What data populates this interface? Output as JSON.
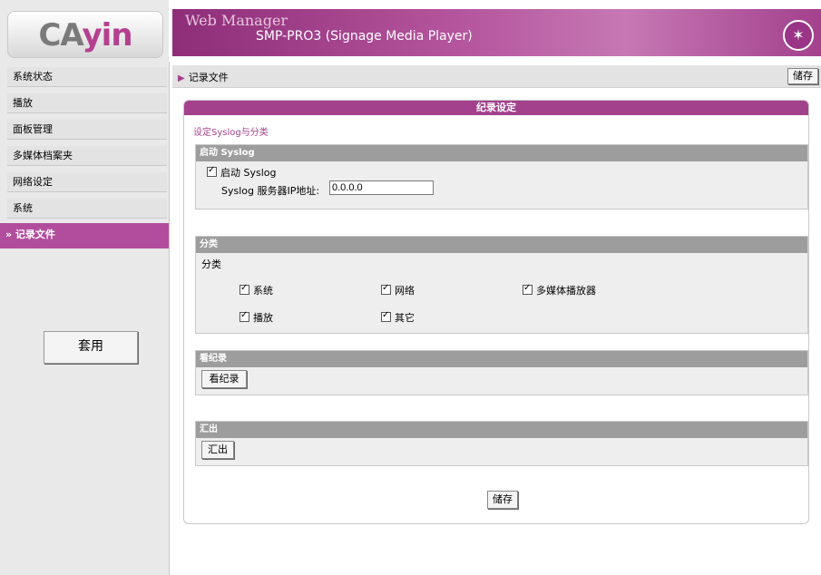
{
  "header": {
    "logo": "CAYIN",
    "title": "Web Manager",
    "subtitle": "SMP-PRO3 (Signage Media Player)",
    "icon": "wizard-icon"
  },
  "sidebar": {
    "items": [
      {
        "label": "系统状态"
      },
      {
        "label": "播放"
      },
      {
        "label": "面板管理"
      },
      {
        "label": "多媒体档案夹"
      },
      {
        "label": "网络设定"
      },
      {
        "label": "系统"
      },
      {
        "label": "» 记录文件"
      }
    ],
    "apply_label": "套用"
  },
  "topbar": {
    "breadcrumb": "记录文件",
    "save_label": "储存"
  },
  "panel": {
    "title": "纪录设定",
    "subtitle": "设定Syslog与分类",
    "syslog": {
      "header": "启动 Syslog",
      "enable_label": "启动 Syslog",
      "ip_label": "Syslog 服务器IP地址:",
      "ip_value": "0.0.0.0"
    },
    "category": {
      "header": "分类",
      "label": "分类",
      "items": [
        "系统",
        "网络",
        "多媒体播放器",
        "播放",
        "其它"
      ]
    },
    "view_log": {
      "header": "看纪录",
      "button_label": "看纪录"
    },
    "export": {
      "header": "汇出",
      "button_label": "汇出"
    },
    "save_label": "储存"
  },
  "colors": {
    "accent": "#a3418d",
    "section_header": "#9d9d9d"
  }
}
